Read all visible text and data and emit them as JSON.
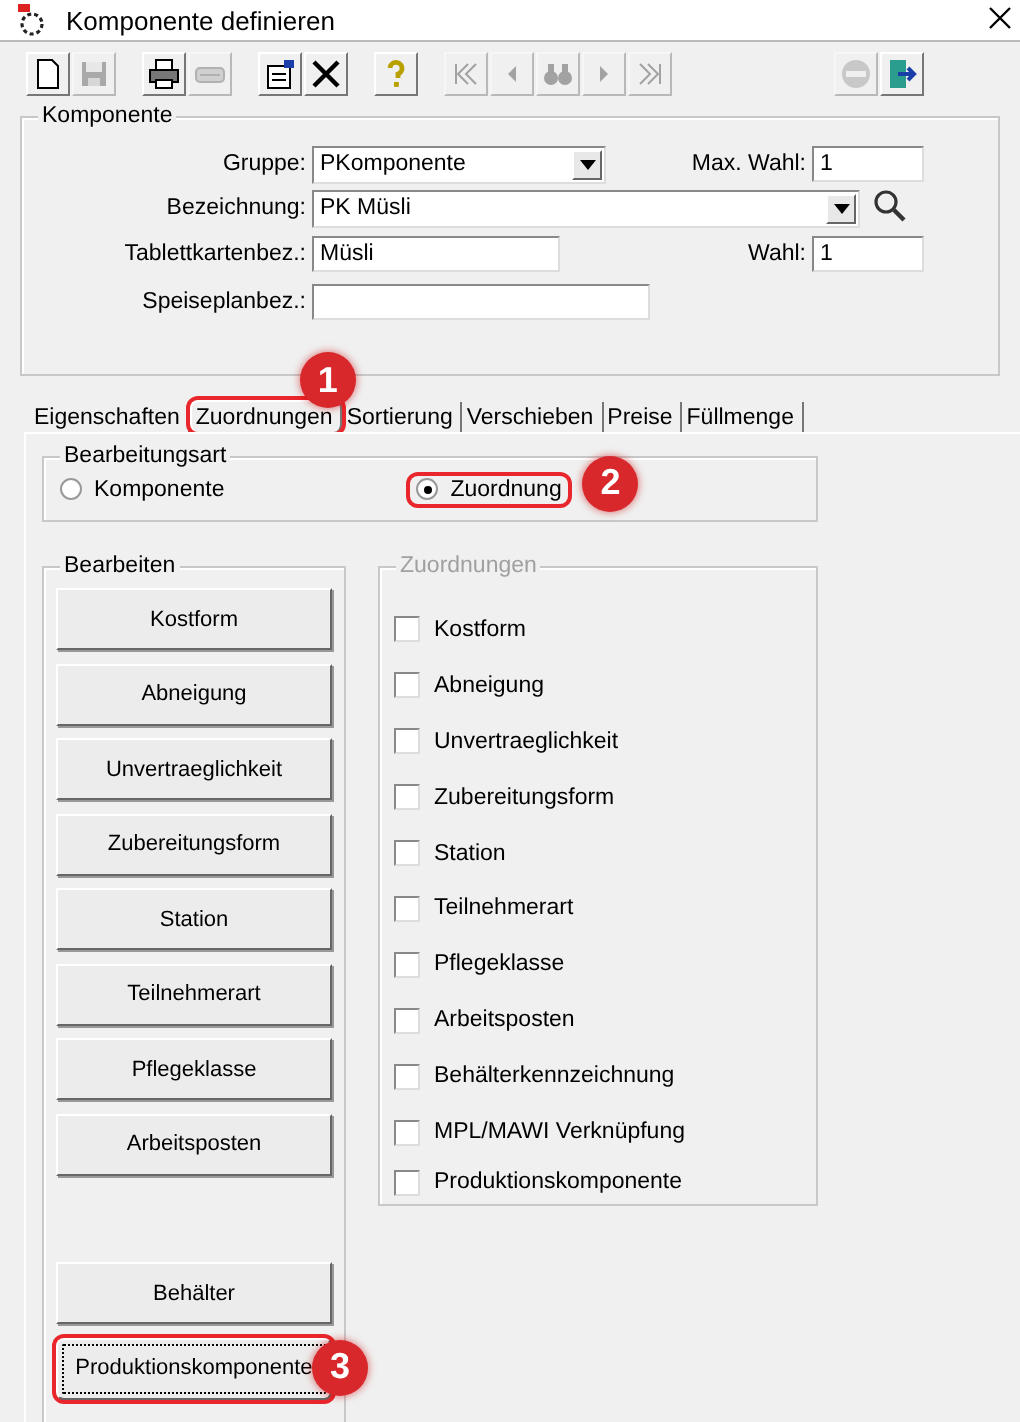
{
  "window": {
    "title": "Komponente definieren"
  },
  "toolbar": [
    {
      "disabled": false
    },
    {
      "disabled": true
    },
    {
      "disabled": false
    },
    {
      "disabled": true
    },
    {
      "disabled": false
    },
    {
      "disabled": false
    },
    {
      "disabled": false
    },
    {
      "disabled": true
    },
    {
      "disabled": true
    },
    {
      "disabled": true
    },
    {
      "disabled": true
    },
    {
      "disabled": true
    },
    {
      "disabled": true
    },
    {
      "disabled": false
    }
  ],
  "komponente": {
    "title": "Komponente",
    "gruppe": {
      "label": "Gruppe:",
      "value": "PKomponente"
    },
    "max_wahl": {
      "label": "Max. Wahl:",
      "value": "1"
    },
    "bezeichnung": {
      "label": "Bezeichnung:",
      "value": "PK Müsli"
    },
    "tablettkartenbez": {
      "label": "Tablettkartenbez.:",
      "value": "Müsli"
    },
    "wahl": {
      "label": "Wahl:",
      "value": "1"
    },
    "speiseplanbez": {
      "label": "Speiseplanbez.:"
    }
  },
  "tabs": [
    {
      "label": "Eigenschaften",
      "selected": false
    },
    {
      "label": "Zuordnungen",
      "selected": true,
      "callout": "1"
    },
    {
      "label": "Sortierung",
      "selected": false
    },
    {
      "label": "Verschieben",
      "selected": false
    },
    {
      "label": "Preise",
      "selected": false
    },
    {
      "label": "Füllmenge",
      "selected": false
    }
  ],
  "bearbeitungsart": {
    "title": "Bearbeitungsart",
    "options": [
      {
        "label": "Komponente",
        "selected": false
      },
      {
        "label": "Zuordnung",
        "selected": true,
        "callout": "2"
      }
    ]
  },
  "bearbeiten": {
    "title": "Bearbeiten",
    "buttons": [
      {
        "label": "Kostform"
      },
      {
        "label": "Abneigung"
      },
      {
        "label": "Unvertraeglichkeit"
      },
      {
        "label": "Zubereitungsform"
      },
      {
        "label": "Station"
      },
      {
        "label": "Teilnehmerart"
      },
      {
        "label": "Pflegeklasse"
      },
      {
        "label": "Arbeitsposten"
      }
    ],
    "bottom_buttons": [
      {
        "label": "Behälter",
        "focused": false
      },
      {
        "label": "Produktionskomponente",
        "focused": true,
        "callout": "3"
      }
    ]
  },
  "zuordnungen": {
    "title": "Zuordnungen",
    "disabled": true,
    "items": [
      {
        "label": "Kostform",
        "checked": false
      },
      {
        "label": "Abneigung",
        "checked": false
      },
      {
        "label": "Unvertraeglichkeit",
        "checked": false
      },
      {
        "label": "Zubereitungsform",
        "checked": false
      },
      {
        "label": "Station",
        "checked": false
      },
      {
        "label": "Teilnehmerart",
        "checked": false
      },
      {
        "label": "Pflegeklasse",
        "checked": false
      },
      {
        "label": "Arbeitsposten",
        "checked": false
      },
      {
        "label": "Behälterkennzeichnung",
        "checked": false
      },
      {
        "label": "MPL/MAWI Verknüpfung",
        "checked": false
      },
      {
        "label": "Produktionskomponente",
        "checked": false
      }
    ]
  }
}
